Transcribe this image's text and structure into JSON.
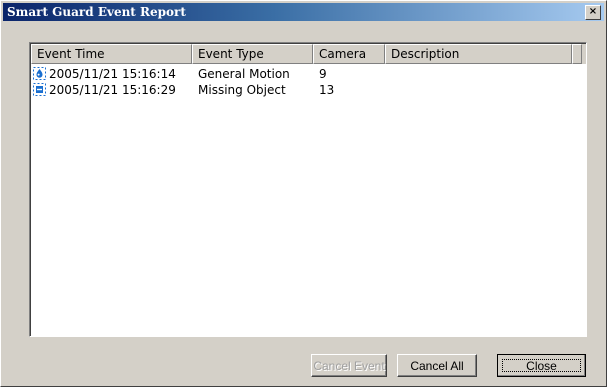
{
  "window": {
    "title": "Smart Guard Event Report",
    "close_glyph": "×"
  },
  "table": {
    "columns": [
      "Event Time",
      "Event Type",
      "Camera",
      "Description"
    ],
    "rows": [
      {
        "icon": "motion-event-icon",
        "time": "2005/11/21 15:16:14",
        "type": "General Motion",
        "camera": "9",
        "description": ""
      },
      {
        "icon": "missing-object-event-icon",
        "time": "2005/11/21 15:16:29",
        "type": "Missing Object",
        "camera": "13",
        "description": ""
      }
    ]
  },
  "buttons": {
    "cancel_event": "Cancel Event",
    "cancel_all": "Cancel All",
    "close": "Close"
  },
  "colors": {
    "title_gradient_start": "#0a246a",
    "title_gradient_end": "#a6caf0",
    "icon_blue": "#1a6fd0",
    "face": "#d4d0c8"
  }
}
